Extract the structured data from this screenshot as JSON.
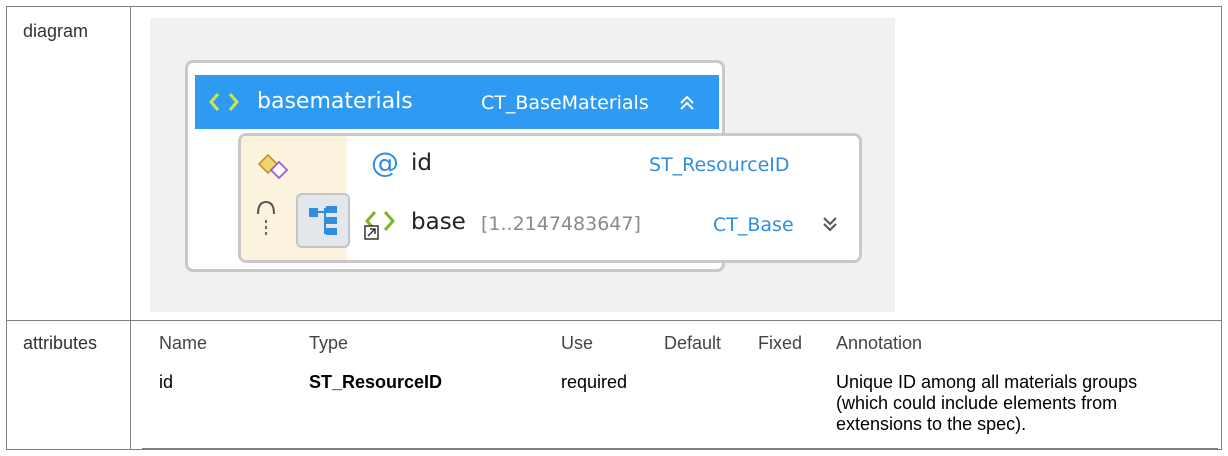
{
  "rows": {
    "diagram_label": "diagram",
    "attributes_label": "attributes"
  },
  "diagram": {
    "element_name": "basematerials",
    "element_type": "CT_BaseMaterials",
    "attribute_prefix": "@",
    "attribute_name": "id",
    "attribute_type": "ST_ResourceID",
    "child_name": "base",
    "child_cardinality": "[1..2147483647]",
    "child_type": "CT_Base",
    "icons": [
      "element-icon",
      "collapse-chevrons-icon",
      "attribute-group-icon",
      "sequence-icon",
      "model-group-icon",
      "child-element-icon",
      "expand-chevrons-icon"
    ],
    "colors": {
      "header": "#2f9af2",
      "type_text": "#2f8ee0",
      "group_bg": "#fbf3dd"
    }
  },
  "attributes_table": {
    "headers": [
      "Name",
      "Type",
      "Use",
      "Default",
      "Fixed",
      "Annotation"
    ],
    "rows": [
      {
        "name": "id",
        "type": "ST_ResourceID",
        "use": "required",
        "default": "",
        "fixed": "",
        "annotation": [
          "Unique ID among all materials groups",
          "(which could include elements from",
          "extensions to the spec)."
        ]
      }
    ]
  }
}
